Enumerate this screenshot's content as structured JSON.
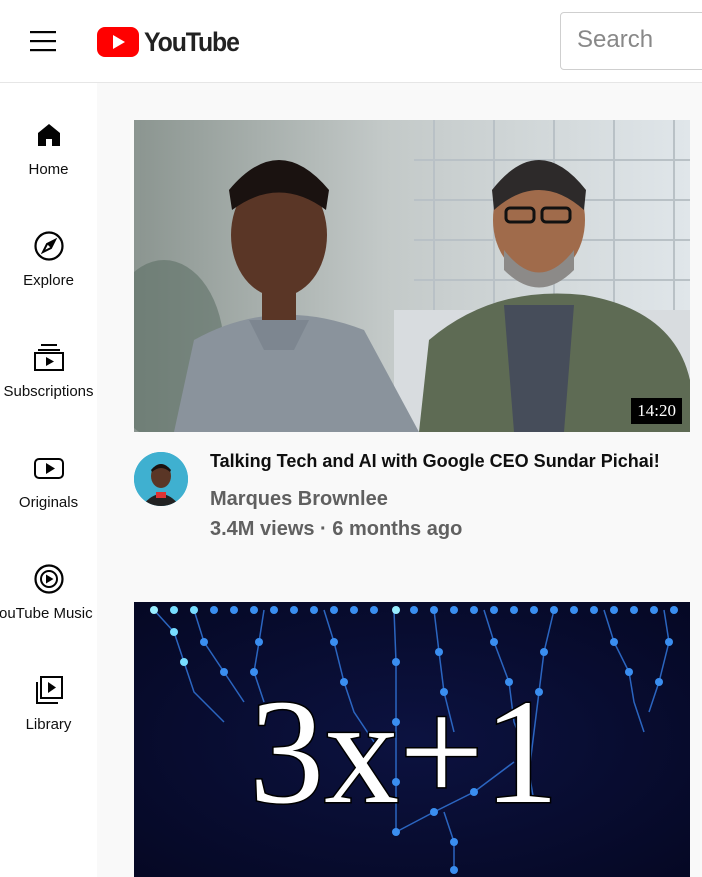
{
  "header": {
    "logo_text": "YouTube",
    "search": {
      "placeholder": "Search",
      "value": ""
    },
    "brand_color": "#ff0000"
  },
  "sidebar": {
    "items": [
      {
        "label": "Home",
        "icon": "home-icon"
      },
      {
        "label": "Explore",
        "icon": "compass-icon"
      },
      {
        "label": "Subscriptions",
        "icon": "subscriptions-icon"
      },
      {
        "label": "Originals",
        "icon": "originals-play-icon"
      },
      {
        "label": "YouTube Music",
        "icon": "music-icon"
      },
      {
        "label": "Library",
        "icon": "library-icon"
      }
    ]
  },
  "videos": [
    {
      "title": "Talking Tech and AI with Google CEO Sundar Pichai!",
      "channel": "Marques Brownlee",
      "stats": "3.4M views · 6 months ago",
      "duration": "14:20"
    },
    {
      "thumbnail_text": "3x+1"
    }
  ]
}
